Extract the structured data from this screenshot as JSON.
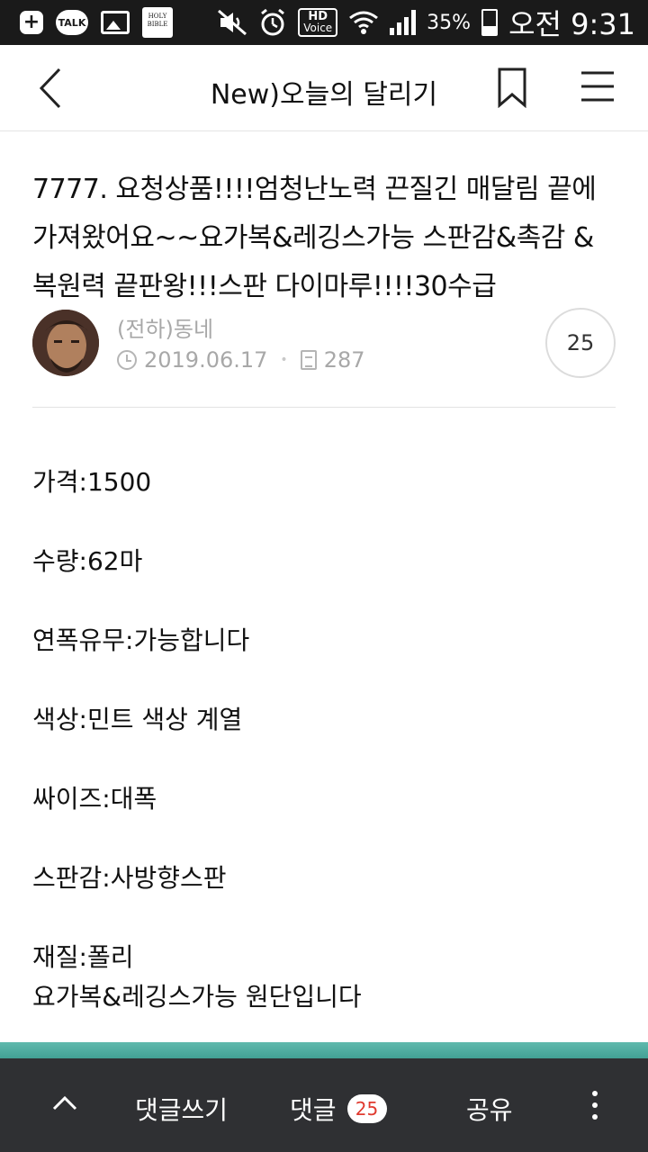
{
  "status_bar": {
    "talk_label": "TALK",
    "bible_label": "HOLY BIBLE",
    "hd_label": "HD",
    "voice_label": "Voice",
    "battery_percent": "35%",
    "battery_level": 0.35,
    "time": "오전 9:31",
    "icons": [
      "plus-icon",
      "kakaotalk-icon",
      "gallery-icon",
      "bible-app-icon",
      "mute-icon",
      "alarm-icon",
      "hd-voice-icon",
      "wifi-icon",
      "signal-icon",
      "battery-icon"
    ]
  },
  "header": {
    "title": "New)오늘의 달리기",
    "icons": [
      "back-chevron-icon",
      "bookmark-icon",
      "menu-icon"
    ]
  },
  "post": {
    "title": "7777. 요청상품!!!!엄청난노력 끈질긴 매달림 끝에 가져왔어요~~요가복&레깅스가능 스판감&촉감 &복원력 끝판왕!!!스판 다이마루!!!!30수급",
    "author": "(전하)동네",
    "date": "2019.06.17",
    "views": "287",
    "comment_count": "25",
    "body_lines": [
      "가격:1500",
      "수량:62마",
      "연폭유무:가능합니다",
      "색상:민트 색상 계열",
      "싸이즈:대폭",
      "스판감:사방향스판",
      "재질:폴리",
      "요가복&레깅스가능 원단입니다"
    ]
  },
  "bottom_bar": {
    "write_comment": "댓글쓰기",
    "comments": "댓글",
    "comments_badge": "25",
    "share": "공유",
    "icons": [
      "chevron-up-icon",
      "more-vertical-icon"
    ],
    "badge_color": "#e03a2f",
    "background": "#2f3033"
  },
  "colors": {
    "accent_teal": "#4aa99c",
    "meta_gray": "#a8a8a8"
  }
}
